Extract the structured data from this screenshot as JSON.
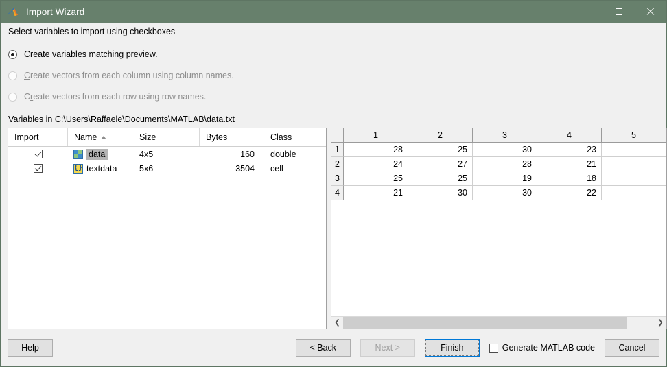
{
  "window": {
    "title": "Import Wizard",
    "icon": "matlab-membrane-icon",
    "titlebar_color": "#67806c",
    "minimize": "minimize-icon",
    "maximize": "maximize-icon",
    "close": "close-icon"
  },
  "header": {
    "instruction": "Select variables to import using checkboxes"
  },
  "options": {
    "items": [
      {
        "label": "Create variables matching preview.",
        "mnemonic": "p",
        "selected": true,
        "enabled": true
      },
      {
        "label": "Create vectors from each column using column names.",
        "mnemonic": "C",
        "selected": false,
        "enabled": false
      },
      {
        "label": "Create vectors from each row using row names.",
        "mnemonic": "r",
        "selected": false,
        "enabled": false
      }
    ]
  },
  "variables_panel": {
    "caption": "Variables in C:\\Users\\Raffaele\\Documents\\MATLAB\\data.txt",
    "columns": [
      "Import",
      "Name",
      "Size",
      "Bytes",
      "Class"
    ],
    "sorted_column": "Name",
    "sort_direction": "ascending",
    "rows": [
      {
        "import": true,
        "icon": "matrix-icon",
        "name": "data",
        "size": "4x5",
        "bytes": "160",
        "class": "double",
        "selected": true
      },
      {
        "import": true,
        "icon": "cell-braces-icon",
        "name": "textdata",
        "size": "5x6",
        "bytes": "3504",
        "class": "cell",
        "selected": false
      }
    ]
  },
  "preview": {
    "column_headers": [
      "1",
      "2",
      "3",
      "4",
      "5"
    ],
    "row_headers": [
      "1",
      "2",
      "3",
      "4"
    ],
    "rows": [
      [
        "28",
        "25",
        "30",
        "23",
        ""
      ],
      [
        "24",
        "27",
        "28",
        "21",
        ""
      ],
      [
        "25",
        "25",
        "19",
        "18",
        ""
      ],
      [
        "21",
        "30",
        "30",
        "22",
        ""
      ]
    ],
    "scroll_left_arrow": "chevron-left-icon",
    "scroll_right_arrow": "chevron-right-icon"
  },
  "footer": {
    "help": "Help",
    "back": "< Back",
    "next": "Next >",
    "next_enabled": false,
    "finish": "Finish",
    "finish_default": true,
    "generate_code_label": "Generate MATLAB code",
    "generate_code_checked": false,
    "cancel": "Cancel"
  },
  "chart_data": {
    "type": "table",
    "title": "Import preview data",
    "categories": [
      "1",
      "2",
      "3",
      "4",
      "5"
    ],
    "series": [
      {
        "name": "1",
        "values": [
          28,
          25,
          30,
          23,
          null
        ]
      },
      {
        "name": "2",
        "values": [
          24,
          27,
          28,
          21,
          null
        ]
      },
      {
        "name": "3",
        "values": [
          25,
          25,
          19,
          18,
          null
        ]
      },
      {
        "name": "4",
        "values": [
          21,
          30,
          30,
          22,
          null
        ]
      }
    ]
  }
}
